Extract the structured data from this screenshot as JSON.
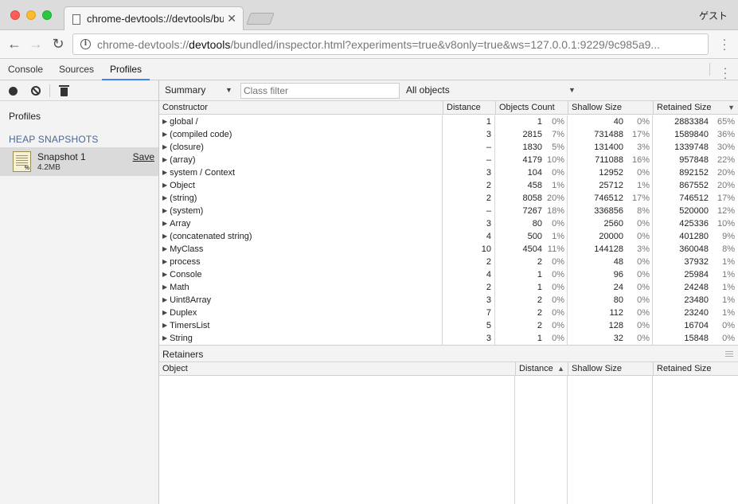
{
  "browser": {
    "tab_title": "chrome-devtools://devtools/bu",
    "profile_name": "ゲスト",
    "url_scheme": "chrome-devtools://",
    "url_host": "devtools",
    "url_path": "/bundled/inspector.html?experiments=true&v8only=true&ws=127.0.0.1:9229/9c985a9..."
  },
  "devtools_tabs": [
    "Console",
    "Sources",
    "Profiles"
  ],
  "active_tab": "Profiles",
  "sidebar": {
    "profiles_label": "Profiles",
    "section_label": "HEAP SNAPSHOTS",
    "snapshot": {
      "title": "Snapshot 1",
      "size": "4.2MB",
      "save_label": "Save"
    }
  },
  "view_bar": {
    "view_mode": "Summary",
    "class_filter_placeholder": "Class filter",
    "objects_scope": "All objects"
  },
  "summary_table": {
    "columns": [
      "Constructor",
      "Distance",
      "Objects Count",
      "Shallow Size",
      "Retained Size"
    ],
    "rows": [
      {
        "name": "global /",
        "distance": "1",
        "count": "1",
        "count_pct": "0%",
        "shallow": "40",
        "shallow_pct": "0%",
        "retained": "2883384",
        "retained_pct": "65%"
      },
      {
        "name": "(compiled code)",
        "distance": "3",
        "count": "2815",
        "count_pct": "7%",
        "shallow": "731488",
        "shallow_pct": "17%",
        "retained": "1589840",
        "retained_pct": "36%"
      },
      {
        "name": "(closure)",
        "distance": "–",
        "count": "1830",
        "count_pct": "5%",
        "shallow": "131400",
        "shallow_pct": "3%",
        "retained": "1339748",
        "retained_pct": "30%"
      },
      {
        "name": "(array)",
        "distance": "–",
        "count": "4179",
        "count_pct": "10%",
        "shallow": "711088",
        "shallow_pct": "16%",
        "retained": "957848",
        "retained_pct": "22%"
      },
      {
        "name": "system / Context",
        "distance": "3",
        "count": "104",
        "count_pct": "0%",
        "shallow": "12952",
        "shallow_pct": "0%",
        "retained": "892152",
        "retained_pct": "20%"
      },
      {
        "name": "Object",
        "distance": "2",
        "count": "458",
        "count_pct": "1%",
        "shallow": "25712",
        "shallow_pct": "1%",
        "retained": "867552",
        "retained_pct": "20%"
      },
      {
        "name": "(string)",
        "distance": "2",
        "count": "8058",
        "count_pct": "20%",
        "shallow": "746512",
        "shallow_pct": "17%",
        "retained": "746512",
        "retained_pct": "17%"
      },
      {
        "name": "(system)",
        "distance": "–",
        "count": "7267",
        "count_pct": "18%",
        "shallow": "336856",
        "shallow_pct": "8%",
        "retained": "520000",
        "retained_pct": "12%"
      },
      {
        "name": "Array",
        "distance": "3",
        "count": "80",
        "count_pct": "0%",
        "shallow": "2560",
        "shallow_pct": "0%",
        "retained": "425336",
        "retained_pct": "10%"
      },
      {
        "name": "(concatenated string)",
        "distance": "4",
        "count": "500",
        "count_pct": "1%",
        "shallow": "20000",
        "shallow_pct": "0%",
        "retained": "401280",
        "retained_pct": "9%"
      },
      {
        "name": "MyClass",
        "distance": "10",
        "count": "4504",
        "count_pct": "11%",
        "shallow": "144128",
        "shallow_pct": "3%",
        "retained": "360048",
        "retained_pct": "8%"
      },
      {
        "name": "process",
        "distance": "2",
        "count": "2",
        "count_pct": "0%",
        "shallow": "48",
        "shallow_pct": "0%",
        "retained": "37932",
        "retained_pct": "1%"
      },
      {
        "name": "Console",
        "distance": "4",
        "count": "1",
        "count_pct": "0%",
        "shallow": "96",
        "shallow_pct": "0%",
        "retained": "25984",
        "retained_pct": "1%"
      },
      {
        "name": "Math",
        "distance": "2",
        "count": "1",
        "count_pct": "0%",
        "shallow": "24",
        "shallow_pct": "0%",
        "retained": "24248",
        "retained_pct": "1%"
      },
      {
        "name": "Uint8Array",
        "distance": "3",
        "count": "2",
        "count_pct": "0%",
        "shallow": "80",
        "shallow_pct": "0%",
        "retained": "23480",
        "retained_pct": "1%"
      },
      {
        "name": "Duplex",
        "distance": "7",
        "count": "2",
        "count_pct": "0%",
        "shallow": "112",
        "shallow_pct": "0%",
        "retained": "23240",
        "retained_pct": "1%"
      },
      {
        "name": "TimersList",
        "distance": "5",
        "count": "2",
        "count_pct": "0%",
        "shallow": "128",
        "shallow_pct": "0%",
        "retained": "16704",
        "retained_pct": "0%"
      },
      {
        "name": "String",
        "distance": "3",
        "count": "1",
        "count_pct": "0%",
        "shallow": "32",
        "shallow_pct": "0%",
        "retained": "15848",
        "retained_pct": "0%"
      }
    ]
  },
  "retainers": {
    "title": "Retainers",
    "columns": [
      "Object",
      "Distance",
      "Shallow Size",
      "Retained Size"
    ]
  },
  "colors": {
    "active_tab_accent": "#3e82f7",
    "section_label": "#4a6792",
    "selected_item_bg": "#dadada"
  }
}
